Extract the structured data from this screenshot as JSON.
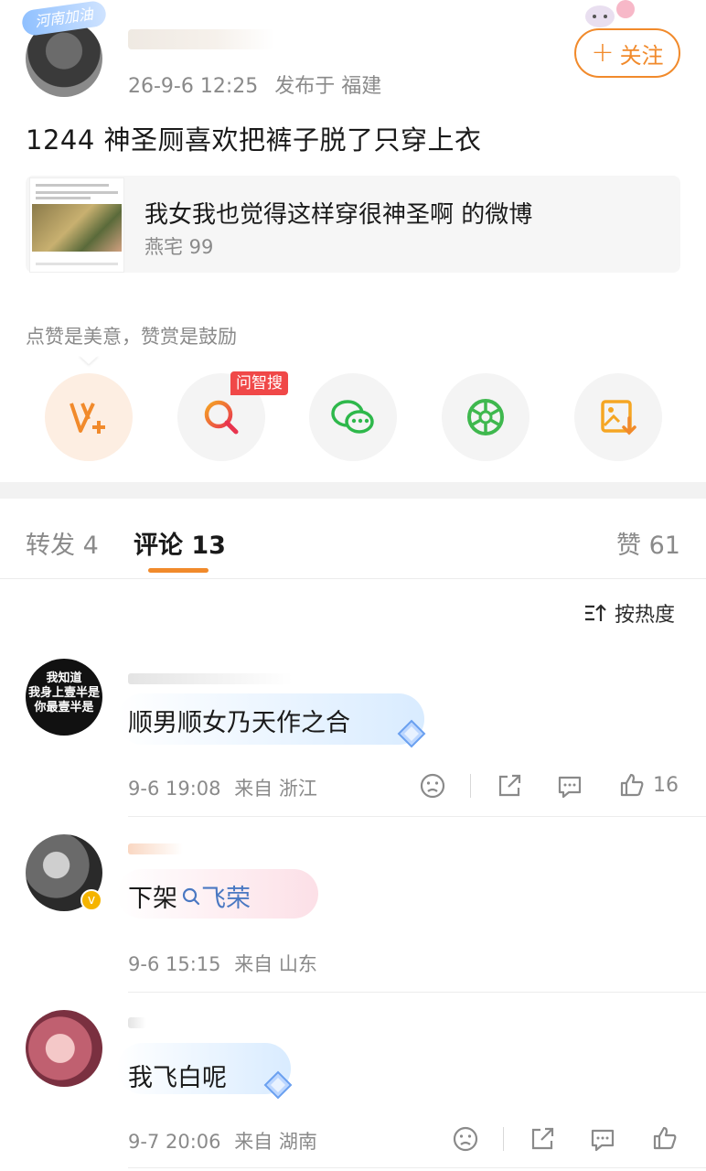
{
  "post": {
    "badge_text": "河南加油",
    "time": "26-9-6 12:25",
    "location": "发布于 福建",
    "follow_label": "关注",
    "text": "1244 神圣厕喜欢把裤子脱了只穿上衣",
    "quote": {
      "title": "我女我也觉得这样穿很神圣啊 的微博",
      "author": "燕宅 99"
    },
    "tip_text": "点赞是美意，赞赏是鼓励",
    "actions": [
      {
        "icon": "vplus-icon"
      },
      {
        "icon": "search-icon",
        "badge": "问智搜"
      },
      {
        "icon": "wechat-icon"
      },
      {
        "icon": "moments-icon"
      },
      {
        "icon": "save-image-icon"
      }
    ]
  },
  "tabs": {
    "repost": "转发 4",
    "comments": "评论 13",
    "likes": "赞 61"
  },
  "sort_label": "按热度",
  "comments": [
    {
      "avatar_text": "我知道\n我身上壹半是\n你最壹半是",
      "text": "顺男顺女乃天作之合",
      "time": "9-6 19:08",
      "location": "来自 浙江",
      "likes": "16"
    },
    {
      "text_prefix": "下架",
      "link_text": "飞荣",
      "time": "9-6 15:15",
      "location": "来自 山东"
    },
    {
      "text": "我飞白呢",
      "time": "9-7 20:06",
      "location": "来自 湖南"
    }
  ],
  "colors": {
    "accent": "#f18a2b",
    "link": "#4a78c2",
    "badge_red": "#f04848",
    "meta_gray": "#8a8a8a"
  }
}
